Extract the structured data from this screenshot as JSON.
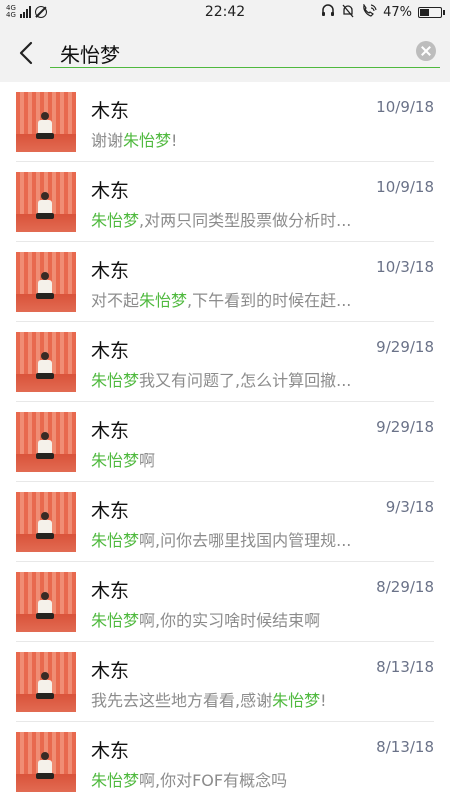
{
  "status_bar": {
    "network": "4G",
    "network2": "4G",
    "time": "22:42",
    "battery": "47%",
    "battery_level": 0.47
  },
  "search": {
    "query": "朱怡梦"
  },
  "results": [
    {
      "name": "木东",
      "date": "10/9/18",
      "preview": [
        {
          "t": "谢谢",
          "h": false
        },
        {
          "t": "朱怡梦",
          "h": true
        },
        {
          "t": "!",
          "h": false
        }
      ]
    },
    {
      "name": "木东",
      "date": "10/9/18",
      "preview": [
        {
          "t": "朱怡梦",
          "h": true
        },
        {
          "t": ",对两只同类型股票做分析时...",
          "h": false
        }
      ]
    },
    {
      "name": "木东",
      "date": "10/3/18",
      "preview": [
        {
          "t": "对不起",
          "h": false
        },
        {
          "t": "朱怡梦",
          "h": true
        },
        {
          "t": ",下午看到的时候在赶...",
          "h": false
        }
      ]
    },
    {
      "name": "木东",
      "date": "9/29/18",
      "preview": [
        {
          "t": "朱怡梦",
          "h": true
        },
        {
          "t": "我又有问题了,怎么计算回撤...",
          "h": false
        }
      ]
    },
    {
      "name": "木东",
      "date": "9/29/18",
      "preview": [
        {
          "t": "朱怡梦",
          "h": true
        },
        {
          "t": "啊",
          "h": false
        }
      ]
    },
    {
      "name": "木东",
      "date": "9/3/18",
      "preview": [
        {
          "t": "朱怡梦",
          "h": true
        },
        {
          "t": "啊,问你去哪里找国内管理规...",
          "h": false
        }
      ]
    },
    {
      "name": "木东",
      "date": "8/29/18",
      "preview": [
        {
          "t": "朱怡梦",
          "h": true
        },
        {
          "t": "啊,你的实习啥时候结束啊",
          "h": false
        }
      ]
    },
    {
      "name": "木东",
      "date": "8/13/18",
      "preview": [
        {
          "t": "我先去这些地方看看,感谢",
          "h": false
        },
        {
          "t": "朱怡梦",
          "h": true
        },
        {
          "t": "!",
          "h": false
        }
      ]
    },
    {
      "name": "木东",
      "date": "8/13/18",
      "preview": [
        {
          "t": "朱怡梦",
          "h": true
        },
        {
          "t": "啊,你对FOF有概念吗",
          "h": false
        }
      ]
    }
  ],
  "colors": {
    "highlight": "#4fb93e",
    "date": "#6a7288",
    "preview": "#8c8c8c"
  },
  "icons": {
    "back": "back-arrow-icon",
    "clear": "clear-icon",
    "signal": "signal-icon",
    "no_sim": "no-sim-icon",
    "headset": "headset-icon",
    "mute": "mute-bell-icon",
    "wifi_call": "wifi-call-icon",
    "battery": "battery-icon"
  }
}
